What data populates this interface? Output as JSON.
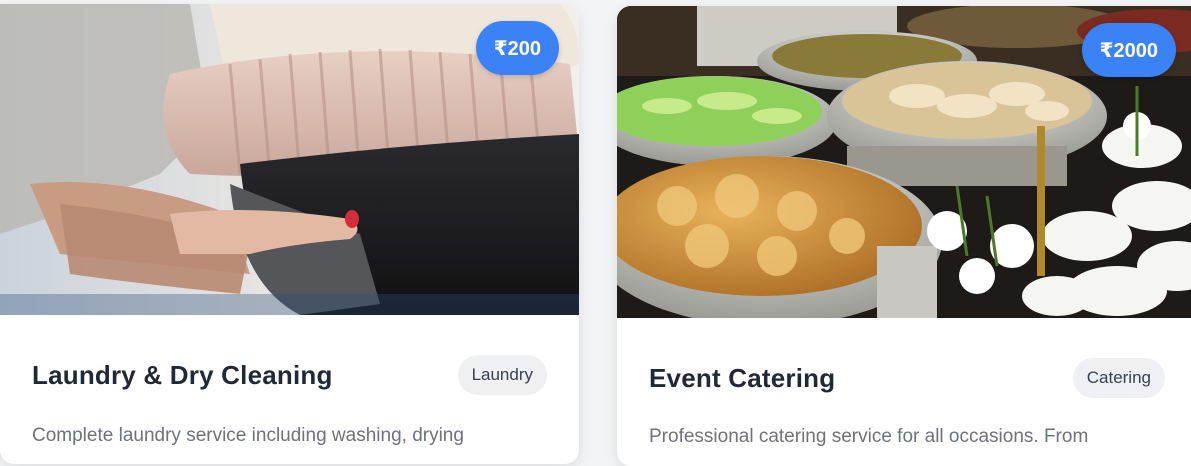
{
  "services": [
    {
      "title": "Laundry & Dry Cleaning",
      "category": "Laundry",
      "price": "₹200",
      "description": "Complete laundry service including washing, drying",
      "image_icon": "folded-sweaters-photo"
    },
    {
      "title": "Event Catering",
      "category": "Catering",
      "price": "₹2000",
      "description": "Professional catering service for all occasions. From",
      "image_icon": "catering-buffet-photo"
    }
  ],
  "colors": {
    "accent": "#3b82f6",
    "title": "#1f2937",
    "tag_bg": "#eef0f4",
    "text_muted": "#6b7280"
  }
}
